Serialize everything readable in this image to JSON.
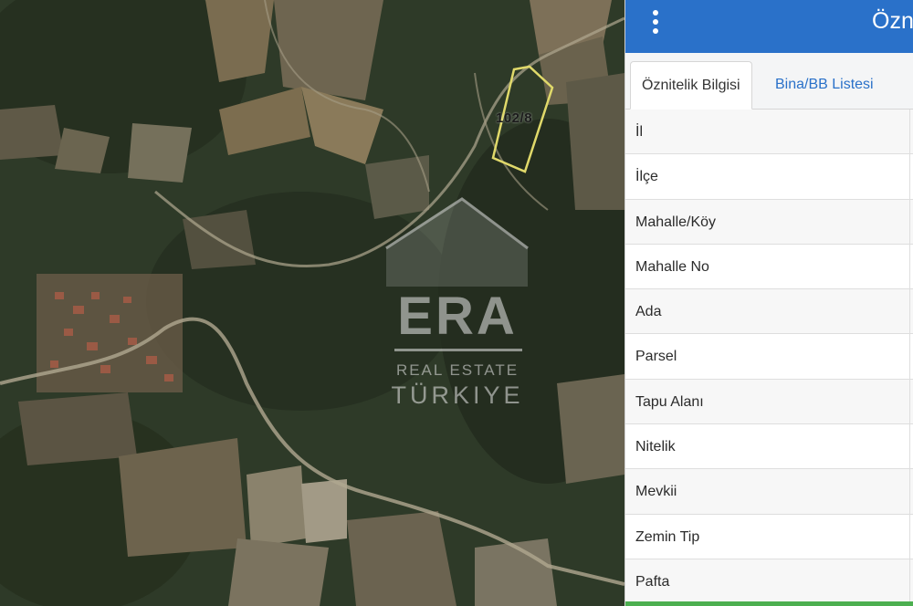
{
  "map": {
    "parcel_label": "102/8",
    "watermark": {
      "brand": "ERA",
      "line1": "REAL ESTATE",
      "line2": "TÜRKIYE"
    }
  },
  "panel": {
    "title": "Özn",
    "menu_icon": "vertical-dots-icon",
    "accent_color": "#2a71c9",
    "tabs": [
      {
        "label": "Öznitelik Bilgisi",
        "active": true
      },
      {
        "label": "Bina/BB Listesi",
        "active": false
      }
    ],
    "rows": [
      {
        "label": "İl"
      },
      {
        "label": "İlçe"
      },
      {
        "label": "Mahalle/Köy"
      },
      {
        "label": "Mahalle No"
      },
      {
        "label": "Ada"
      },
      {
        "label": "Parsel"
      },
      {
        "label": "Tapu Alanı"
      },
      {
        "label": "Nitelik"
      },
      {
        "label": "Mevkii"
      },
      {
        "label": "Zemin Tip"
      },
      {
        "label": "Pafta"
      }
    ]
  }
}
